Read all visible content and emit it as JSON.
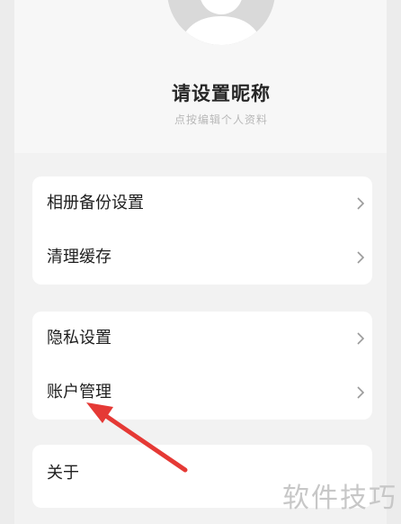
{
  "profile": {
    "nickname": "请设置昵称",
    "subtitle": "点按编辑个人资料"
  },
  "groups": [
    {
      "items": [
        {
          "label": "相册备份设置"
        },
        {
          "label": "清理缓存"
        }
      ]
    },
    {
      "items": [
        {
          "label": "隐私设置"
        },
        {
          "label": "账户管理"
        }
      ]
    },
    {
      "items": [
        {
          "label": "关于"
        }
      ]
    }
  ],
  "watermark": "软件技巧",
  "annotation": {
    "arrow_color": "#e53935",
    "icon": "red-arrow-icon"
  },
  "colors": {
    "background": "#f2f2f2",
    "card": "#ffffff",
    "chevron": "#9a9a9a"
  }
}
